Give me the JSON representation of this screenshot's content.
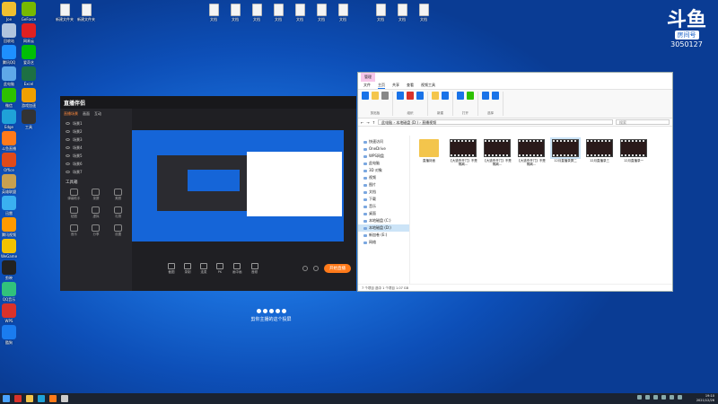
{
  "desktop": {
    "left_icons": [
      {
        "label": "Joe",
        "color": "#f0c030"
      },
      {
        "label": "回收站",
        "color": "#b0c4de"
      },
      {
        "label": "腾讯QQ",
        "color": "#1e90ff"
      },
      {
        "label": "此电脑",
        "color": "#5fa8e8"
      },
      {
        "label": "微信",
        "color": "#2dc100"
      },
      {
        "label": "Edge",
        "color": "#1fa2d8"
      },
      {
        "label": "斗鱼直播",
        "color": "#ff7a1a"
      },
      {
        "label": "Office",
        "color": "#e04a1a"
      },
      {
        "label": "英雄联盟",
        "color": "#c8a050"
      },
      {
        "label": "迅雷",
        "color": "#3ab0f0"
      },
      {
        "label": "腾讯视频",
        "color": "#ff9a00"
      },
      {
        "label": "WeGame",
        "color": "#f2c200"
      },
      {
        "label": "剪映",
        "color": "#222"
      },
      {
        "label": "QQ音乐",
        "color": "#31c27c"
      },
      {
        "label": "WPS",
        "color": "#d9322b"
      },
      {
        "label": "酷狗",
        "color": "#1a7cf0"
      },
      {
        "label": "GeForce",
        "color": "#76b900"
      },
      {
        "label": "网易云",
        "color": "#e02020"
      },
      {
        "label": "爱奇艺",
        "color": "#00be06"
      },
      {
        "label": "Excel",
        "color": "#1d7044"
      },
      {
        "label": "游戏加速",
        "color": "#f0a000"
      },
      {
        "label": "工具",
        "color": "#333"
      }
    ],
    "top_icons": [
      {
        "label": "新建文件夹"
      },
      {
        "label": "新建文件夹"
      },
      {
        "label": "文档"
      },
      {
        "label": "文档"
      },
      {
        "label": "文档"
      },
      {
        "label": "文档"
      },
      {
        "label": "文档"
      },
      {
        "label": "文档"
      },
      {
        "label": "文档"
      },
      {
        "label": "文档"
      },
      {
        "label": "文档"
      },
      {
        "label": "文档"
      }
    ]
  },
  "badge": {
    "logo": "斗鱼",
    "room_label": "房间号",
    "room_number": "3050127"
  },
  "streamer": {
    "brand": "直播伴侣",
    "version": "",
    "tabs": [
      "直播场景",
      "画面",
      "互动"
    ],
    "scenes": [
      "场景1",
      "场景2",
      "场景3",
      "场景4",
      "场景5",
      "场景6",
      "场景7"
    ],
    "tools_title": "工具箱",
    "tools": [
      "弹幕助手",
      "录屏",
      "美颜",
      "贴图",
      "虚拟",
      "礼物",
      "音乐",
      "分享",
      "设置"
    ],
    "stream_title": "",
    "bottom_buttons": [
      "截图",
      "录制",
      "连麦",
      "PK",
      "画中画",
      "音频"
    ],
    "go_live": "开始直播"
  },
  "explorer": {
    "context_tab": "管理",
    "menu": [
      "文件",
      "主页",
      "共享",
      "查看",
      "视频工具"
    ],
    "ribbon_groups": [
      "剪贴板",
      "组织",
      "新建",
      "打开",
      "选择"
    ],
    "address": "此电脑 › 本地磁盘 (D:) › 直播视频",
    "search_placeholder": "搜索",
    "nav": [
      "快速访问",
      "OneDrive",
      "WPS网盘",
      "此电脑",
      "3D 对象",
      "视频",
      "图片",
      "文档",
      "下载",
      "音乐",
      "桌面",
      "本地磁盘 (C:)",
      "本地磁盘 (D:)",
      "新加卷 (E:)",
      "网络"
    ],
    "nav_selected": 12,
    "files": [
      {
        "name": "直播封面",
        "type": "folder"
      },
      {
        "name": "【大逃杀开门】不是隔离...",
        "type": "video"
      },
      {
        "name": "【大逃杀开门】不是隔离...",
        "type": "video"
      },
      {
        "name": "【大逃杀开门】不是隔离...",
        "type": "video"
      },
      {
        "name": "12月直播录屏二",
        "type": "video"
      },
      {
        "name": "12月直播录三",
        "type": "video"
      },
      {
        "name": "12月直播录一",
        "type": "video"
      }
    ],
    "status": "7 个项目   选中 1 个项目 1.07 GB"
  },
  "caption": "剪你主播的这个投屏",
  "taskbar": {
    "time": "19:10",
    "date": "2021/12/26"
  }
}
